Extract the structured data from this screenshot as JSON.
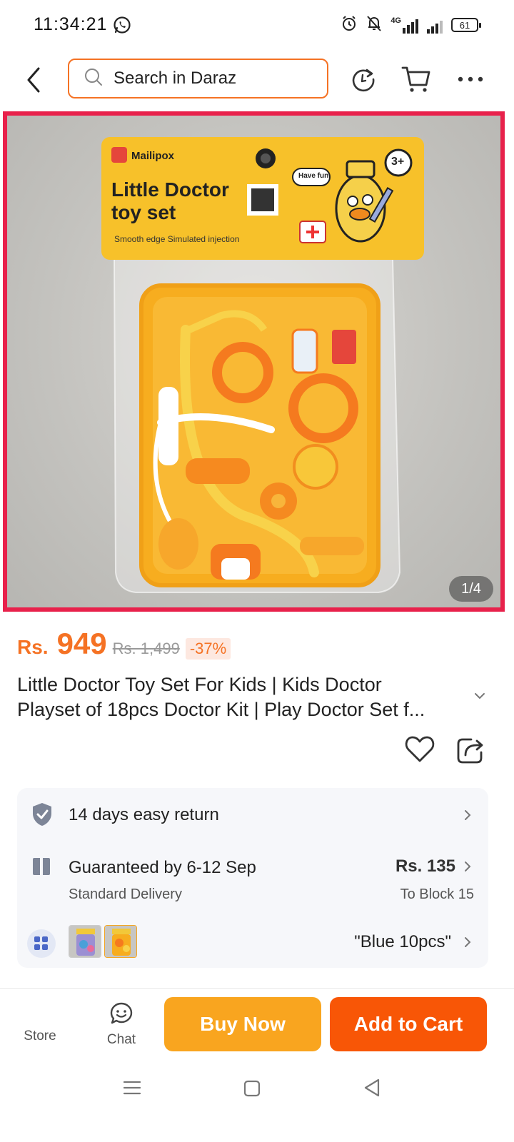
{
  "status_bar": {
    "time": "11:34:21",
    "network": "4G",
    "battery": "61",
    "icons": [
      "whatsapp-icon",
      "alarm-icon",
      "bell-off-icon",
      "signal-icon",
      "battery-icon"
    ]
  },
  "header": {
    "search_placeholder": "Search in Daraz",
    "icons": [
      "back-arrow-icon",
      "search-icon",
      "refresh-icon",
      "cart-icon",
      "more-icon"
    ]
  },
  "gallery": {
    "pager": "1/4",
    "package_brand": "Mailipox",
    "package_title_line1": "Little Doctor",
    "package_title_line2": "toy set",
    "package_age": "3+",
    "package_bubble": "Have fun",
    "package_features": "Smooth edge  Simulated injection"
  },
  "product": {
    "currency": "Rs.",
    "price": "949",
    "old_price": "Rs. 1,499",
    "discount": "-37%",
    "title_line1": "Little Doctor Toy Set For Kids | Kids Doctor",
    "title_line2": "Playset of 18pcs Doctor Kit | Play Doctor Set f..."
  },
  "services": {
    "return_text": "14 days easy return",
    "delivery_text": "Guaranteed by 6-12 Sep",
    "delivery_type": "Standard Delivery",
    "delivery_fee": "Rs. 135",
    "delivery_to": "To Block 15",
    "variant_selected": "\"Blue 10pcs\""
  },
  "bottom_bar": {
    "store_label": "Store",
    "chat_label": "Chat",
    "buy_now_label": "Buy Now",
    "add_to_cart_label": "Add to Cart"
  },
  "colors": {
    "accent": "#f57224",
    "buy_now": "#f9a51f",
    "add_to_cart": "#f85606",
    "hero_border": "#e8214b"
  }
}
